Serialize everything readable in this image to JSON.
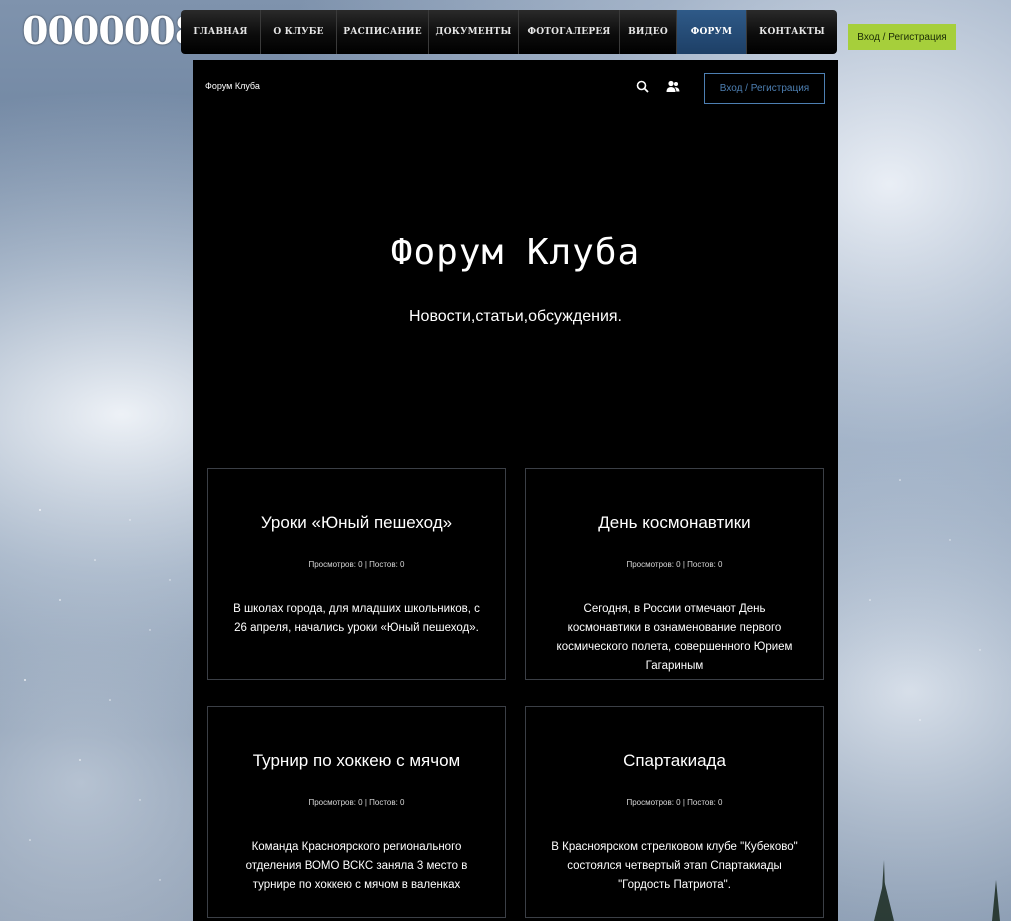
{
  "logo": {
    "text": "0000008"
  },
  "nav": {
    "items": [
      {
        "label": "ГЛАВНАЯ"
      },
      {
        "label": "О КЛУБЕ"
      },
      {
        "label": "РАСПИСАНИЕ"
      },
      {
        "label": "ДОКУМЕНТЫ"
      },
      {
        "label": "ФОТОГАЛЕРЕЯ"
      },
      {
        "label": "ВИДЕО"
      },
      {
        "label": "ФОРУМ"
      },
      {
        "label": "КОНТАКТЫ"
      }
    ],
    "active_label": "ФОРУМ",
    "login_label": "Вход / Регистрация"
  },
  "forum_bar": {
    "name": "Форум Клуба",
    "search_icon": "search-icon",
    "members_icon": "members-icon",
    "login_label": "Вход / Регистрация"
  },
  "hero": {
    "title": "Форум Клуба",
    "subtitle": "Новости,статьи,обсуждения."
  },
  "cards": [
    {
      "title": "Уроки «Юный пешеход»",
      "stats": "Просмотров: 0 | Постов: 0",
      "text": "В школах города, для младших школьников, с 26 апреля, начались уроки «Юный пешеход»."
    },
    {
      "title": "День космонавтики",
      "stats": "Просмотров: 0 | Постов: 0",
      "text": "Сегодня, в России отмечают День космонавтики в ознаменование первого космического полета, совершенного Юрием Гагариным"
    },
    {
      "title": "Турнир по хоккею с мячом",
      "stats": "Просмотров: 0 | Постов: 0",
      "text": "Команда Красноярского регионального отделения ВОМО ВСКС заняла 3 место в турнире по хоккею с мячом в валенках"
    },
    {
      "title": "Спартакиада",
      "stats": "Просмотров: 0 | Постов: 0",
      "text": "В Красноярском стрелковом клубе \"Кубеково\" состоялся четвертый этап Спартакиады \"Гордость Патриота\"."
    }
  ],
  "colors": {
    "login_green": "#a6cf3b",
    "nav_active": "#2f5a88",
    "login_outline": "#4d7fb2",
    "panel_bg": "#000000"
  }
}
